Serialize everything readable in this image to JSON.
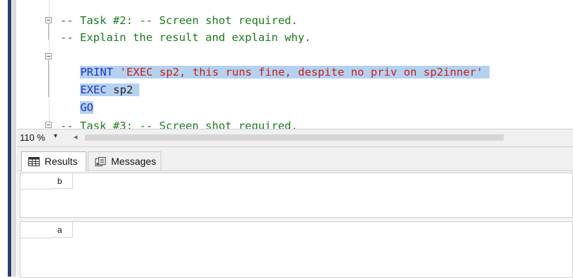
{
  "editor": {
    "lines": [
      {
        "text": "-- Task #2: -- Screen shot required."
      },
      {
        "text": "-- Explain the result and explain why."
      },
      {
        "keyword": "PRINT",
        "string": "'EXEC sp2, this runs fine, despite no priv on sp2inner'"
      },
      {
        "keyword": "EXEC",
        "plain": "sp2"
      },
      {
        "keyword": "GO"
      },
      {
        "text": "-- Task #3: -- Screen shot required."
      }
    ]
  },
  "statusbar": {
    "zoom": "110 %",
    "zoom_caret": "▾",
    "scroll_left": "◂"
  },
  "tabs": [
    {
      "label": "Results",
      "icon": "grid-icon"
    },
    {
      "label": "Messages",
      "icon": "messages-icon"
    }
  ],
  "results": [
    {
      "column": "b"
    },
    {
      "column": "a"
    }
  ],
  "colors": {
    "comment": "#1e7a1e",
    "keyword": "#1e33c8",
    "string": "#c8201a",
    "selection": "#b4d2f0"
  }
}
